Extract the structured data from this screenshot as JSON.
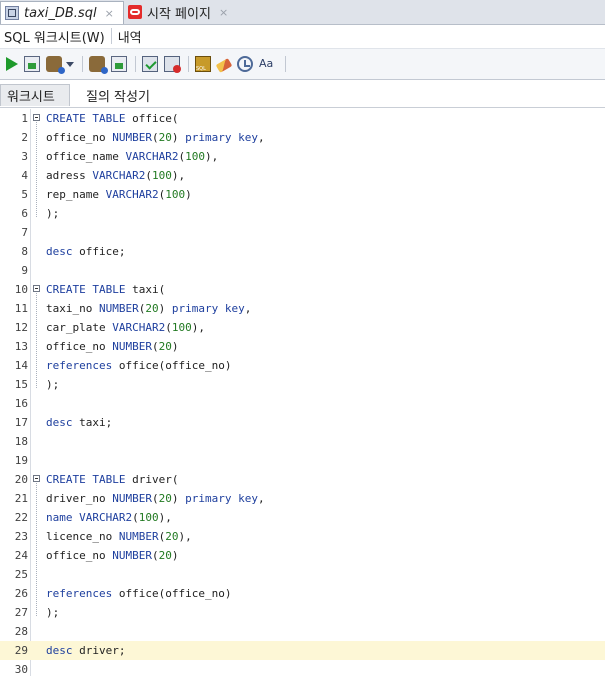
{
  "tabs": [
    {
      "label": "taxi_DB.sql",
      "icon": "sql-file-icon",
      "close": "×",
      "active": true
    },
    {
      "label": "시작 페이지",
      "icon": "oracle-icon",
      "close": "×",
      "active": false
    }
  ],
  "menu": {
    "worksheet": "SQL 워크시트(W)",
    "history": "내역"
  },
  "subtabs": {
    "worksheet": "워크시트",
    "query_builder": "질의 작성기"
  },
  "editor": {
    "current_line": 29,
    "lines": [
      {
        "n": "1",
        "fold": true,
        "tokens": [
          [
            "kw",
            "CREATE TABLE"
          ],
          [
            "t",
            " office("
          ]
        ]
      },
      {
        "n": "2",
        "fold": false,
        "tokens": [
          [
            "t",
            "office_no "
          ],
          [
            "ty",
            "NUMBER"
          ],
          [
            "t",
            "("
          ],
          [
            "num",
            "20"
          ],
          [
            "t",
            ") "
          ],
          [
            "kw",
            "primary key"
          ],
          [
            "t",
            ","
          ]
        ]
      },
      {
        "n": "3",
        "fold": false,
        "tokens": [
          [
            "t",
            "office_name "
          ],
          [
            "ty",
            "VARCHAR2"
          ],
          [
            "t",
            "("
          ],
          [
            "num",
            "100"
          ],
          [
            "t",
            "),"
          ]
        ]
      },
      {
        "n": "4",
        "fold": false,
        "tokens": [
          [
            "t",
            "adress "
          ],
          [
            "ty",
            "VARCHAR2"
          ],
          [
            "t",
            "("
          ],
          [
            "num",
            "100"
          ],
          [
            "t",
            "),"
          ]
        ]
      },
      {
        "n": "5",
        "fold": false,
        "tokens": [
          [
            "t",
            "rep_name "
          ],
          [
            "ty",
            "VARCHAR2"
          ],
          [
            "t",
            "("
          ],
          [
            "num",
            "100"
          ],
          [
            "t",
            ")"
          ]
        ]
      },
      {
        "n": "6",
        "fold": false,
        "tokens": [
          [
            "t",
            ");"
          ]
        ]
      },
      {
        "n": "7",
        "fold": false,
        "tokens": []
      },
      {
        "n": "8",
        "fold": false,
        "tokens": [
          [
            "kw",
            "desc"
          ],
          [
            "t",
            " office;"
          ]
        ]
      },
      {
        "n": "9",
        "fold": false,
        "tokens": []
      },
      {
        "n": "10",
        "fold": true,
        "tokens": [
          [
            "kw",
            "CREATE TABLE"
          ],
          [
            "t",
            " taxi("
          ]
        ]
      },
      {
        "n": "11",
        "fold": false,
        "tokens": [
          [
            "t",
            "taxi_no "
          ],
          [
            "ty",
            "NUMBER"
          ],
          [
            "t",
            "("
          ],
          [
            "num",
            "20"
          ],
          [
            "t",
            ") "
          ],
          [
            "kw",
            "primary key"
          ],
          [
            "t",
            ","
          ]
        ]
      },
      {
        "n": "12",
        "fold": false,
        "tokens": [
          [
            "t",
            "car_plate "
          ],
          [
            "ty",
            "VARCHAR2"
          ],
          [
            "t",
            "("
          ],
          [
            "num",
            "100"
          ],
          [
            "t",
            "),"
          ]
        ]
      },
      {
        "n": "13",
        "fold": false,
        "tokens": [
          [
            "t",
            "office_no "
          ],
          [
            "ty",
            "NUMBER"
          ],
          [
            "t",
            "("
          ],
          [
            "num",
            "20"
          ],
          [
            "t",
            ")"
          ]
        ]
      },
      {
        "n": "14",
        "fold": false,
        "tokens": [
          [
            "kw",
            "references"
          ],
          [
            "t",
            " office(office_no)"
          ]
        ]
      },
      {
        "n": "15",
        "fold": false,
        "tokens": [
          [
            "t",
            ");"
          ]
        ]
      },
      {
        "n": "16",
        "fold": false,
        "tokens": []
      },
      {
        "n": "17",
        "fold": false,
        "tokens": [
          [
            "kw",
            "desc"
          ],
          [
            "t",
            " taxi;"
          ]
        ]
      },
      {
        "n": "18",
        "fold": false,
        "tokens": []
      },
      {
        "n": "19",
        "fold": false,
        "tokens": []
      },
      {
        "n": "20",
        "fold": true,
        "tokens": [
          [
            "kw",
            "CREATE TABLE"
          ],
          [
            "t",
            " driver("
          ]
        ]
      },
      {
        "n": "21",
        "fold": false,
        "tokens": [
          [
            "t",
            "driver_no "
          ],
          [
            "ty",
            "NUMBER"
          ],
          [
            "t",
            "("
          ],
          [
            "num",
            "20"
          ],
          [
            "t",
            ") "
          ],
          [
            "kw",
            "primary key"
          ],
          [
            "t",
            ","
          ]
        ]
      },
      {
        "n": "22",
        "fold": false,
        "tokens": [
          [
            "kw",
            "name"
          ],
          [
            "t",
            " "
          ],
          [
            "ty",
            "VARCHAR2"
          ],
          [
            "t",
            "("
          ],
          [
            "num",
            "100"
          ],
          [
            "t",
            "),"
          ]
        ]
      },
      {
        "n": "23",
        "fold": false,
        "tokens": [
          [
            "t",
            "licence_no "
          ],
          [
            "ty",
            "NUMBER"
          ],
          [
            "t",
            "("
          ],
          [
            "num",
            "20"
          ],
          [
            "t",
            "),"
          ]
        ]
      },
      {
        "n": "24",
        "fold": false,
        "tokens": [
          [
            "t",
            "office_no "
          ],
          [
            "ty",
            "NUMBER"
          ],
          [
            "t",
            "("
          ],
          [
            "num",
            "20"
          ],
          [
            "t",
            ")"
          ]
        ]
      },
      {
        "n": "25",
        "fold": false,
        "tokens": []
      },
      {
        "n": "26",
        "fold": false,
        "tokens": [
          [
            "kw",
            "references"
          ],
          [
            "t",
            " office(office_no)"
          ]
        ]
      },
      {
        "n": "27",
        "fold": false,
        "tokens": [
          [
            "t",
            ");"
          ]
        ]
      },
      {
        "n": "28",
        "fold": false,
        "tokens": []
      },
      {
        "n": "29",
        "fold": false,
        "tokens": [
          [
            "kw",
            "desc"
          ],
          [
            "t",
            " driver;"
          ]
        ]
      },
      {
        "n": "30",
        "fold": false,
        "tokens": []
      }
    ]
  }
}
